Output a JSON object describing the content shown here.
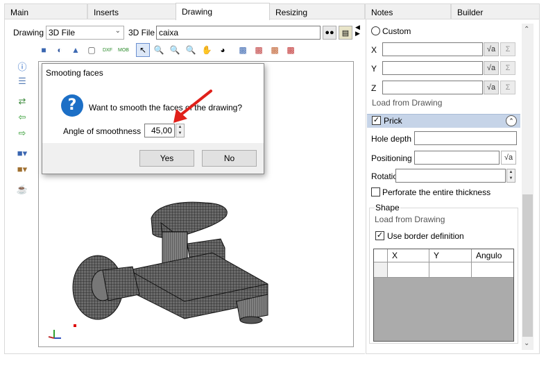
{
  "tabs": [
    {
      "label": "Main"
    },
    {
      "label": "Inserts"
    },
    {
      "label": "Drawing"
    },
    {
      "label": "Resizing"
    },
    {
      "label": "Notes"
    },
    {
      "label": "Builder"
    }
  ],
  "toolbar": {
    "drawing_label": "Drawing",
    "drawing_select_value": "3D File",
    "file_label": "3D File",
    "file_value": "caixa"
  },
  "dialog": {
    "title": "Smooting faces",
    "message": "Want to smooth the faces of the drawing?",
    "angle_label": "Angle of smoothness",
    "angle_value": "45,00",
    "yes_label": "Yes",
    "no_label": "No"
  },
  "right_panel": {
    "custom_label": "Custom",
    "x_label": "X",
    "y_label": "Y",
    "z_label": "Z",
    "load_from_drawing": "Load from Drawing",
    "prick_label": "Prick",
    "hole_depth_label": "Hole depth",
    "positioning_label": "Positioning",
    "rotation_label": "Rotation",
    "perforate_label": "Perforate the entire thickness",
    "shape_label": "Shape",
    "shape_load_label": "Load from Drawing",
    "use_border_label": "Use border definition",
    "table_headers": [
      "X",
      "Y",
      "Angulo"
    ]
  },
  "colors": {
    "section_bar": "#c6d4e8",
    "help_icon": "#1c6fc6",
    "arrow": "#e0201a"
  }
}
